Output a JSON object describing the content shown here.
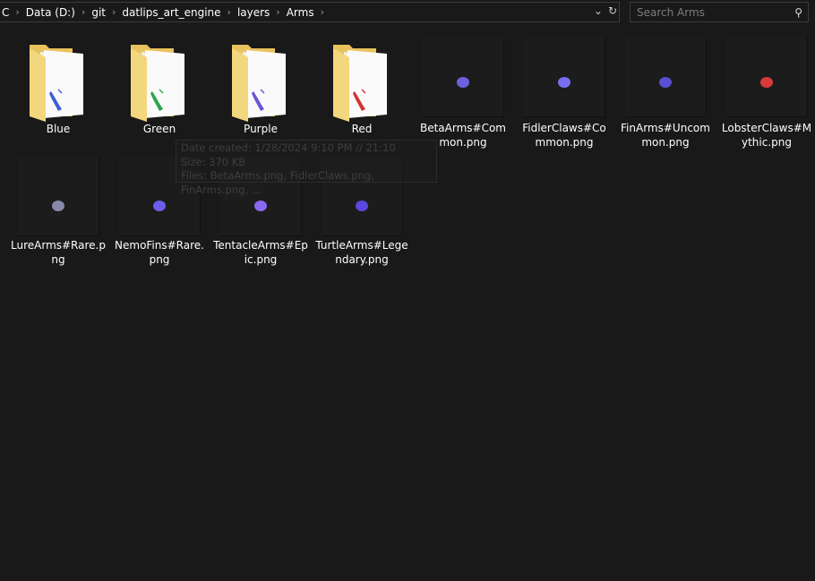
{
  "breadcrumb": [
    "C",
    "Data (D:)",
    "git",
    "datlips_art_engine",
    "layers",
    "Arms"
  ],
  "search": {
    "placeholder": "Search Arms"
  },
  "folders": [
    {
      "name": "Blue",
      "color": "#3a5fd6"
    },
    {
      "name": "Green",
      "color": "#2fa34a"
    },
    {
      "name": "Purple",
      "color": "#6a55d8"
    },
    {
      "name": "Red",
      "color": "#d33434"
    }
  ],
  "files": [
    {
      "name": "BetaArms#Common.png",
      "line1": "BetaArms#Com",
      "line2": "mon.png",
      "color": "#6b62e0"
    },
    {
      "name": "FidlerClaws#Common.png",
      "line1": "FidlerClaws#Co",
      "line2": "mmon.png",
      "color": "#7a6ef0"
    },
    {
      "name": "FinArms#Uncommon.png",
      "line1": "FinArms#Uncom",
      "line2": "mon.png",
      "color": "#5a4fd0"
    },
    {
      "name": "LobsterClaws#Mythic.png",
      "line1": "LobsterClaws#M",
      "line2": "ythic.png",
      "color": "#d83a3a"
    },
    {
      "name": "LureArms#Rare.png",
      "line1": "LureArms#Rare.p",
      "line2": "ng",
      "color": "#8888aa"
    },
    {
      "name": "NemoFins#Rare.png",
      "line1": "NemoFins#Rare.",
      "line2": "png",
      "color": "#6b5ee8"
    },
    {
      "name": "TentacleArms#Epic.png",
      "line1": "TentacleArms#Ep",
      "line2": "ic.png",
      "color": "#8a6af0"
    },
    {
      "name": "TurtleArms#Legendary.png",
      "line1": "TurtleArms#Lege",
      "line2": "ndary.png",
      "color": "#5a48e0"
    }
  ],
  "tooltip": {
    "date": "Date created: 1/28/2024 9:10 PM // 21:10",
    "size": "Size: 370 KB",
    "files": "Files: BetaArms.png, FidlerClaws.png, FinArms.png, ..."
  }
}
